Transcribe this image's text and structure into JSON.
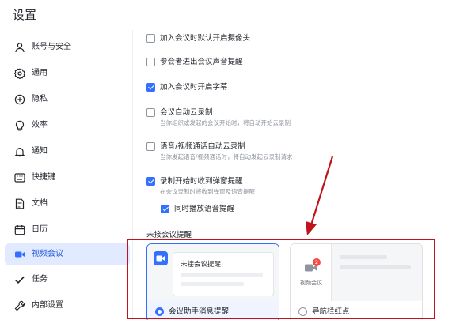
{
  "window": {
    "title": "设置"
  },
  "sidebar": {
    "items": [
      {
        "label": "账号与安全",
        "icon": "user-icon",
        "active": false
      },
      {
        "label": "通用",
        "icon": "gear-icon",
        "active": false
      },
      {
        "label": "隐私",
        "icon": "shield-icon",
        "active": false
      },
      {
        "label": "效率",
        "icon": "bulb-icon",
        "active": false
      },
      {
        "label": "通知",
        "icon": "bell-icon",
        "active": false
      },
      {
        "label": "快捷键",
        "icon": "keyboard-icon",
        "active": false
      },
      {
        "label": "文档",
        "icon": "document-icon",
        "active": false
      },
      {
        "label": "日历",
        "icon": "calendar-icon",
        "active": false
      },
      {
        "label": "视频会议",
        "icon": "video-camera-icon",
        "active": true
      },
      {
        "label": "任务",
        "icon": "check-icon",
        "active": false
      },
      {
        "label": "内部设置",
        "icon": "wrench-icon",
        "active": false
      }
    ]
  },
  "options": [
    {
      "label": "加入会议时默认开启摄像头",
      "desc": "",
      "checked": false
    },
    {
      "label": "参会者进出会议声音提醒",
      "desc": "",
      "checked": false
    },
    {
      "label": "加入会议时开启字幕",
      "desc": "",
      "checked": true
    },
    {
      "label": "会议自动云录制",
      "desc": "当你组织或发起的会议开始时，将自动开始云录制",
      "checked": false
    },
    {
      "label": "语音/视频通话自动云录制",
      "desc": "当你发起语音/视频通话时，将自动发起云录制请求",
      "checked": false
    },
    {
      "label": "录制开始时收到弹窗提醒",
      "desc": "在会议录制时将收到弹窗及语音提醒",
      "checked": true
    },
    {
      "label": "同时播放语音提醒",
      "desc": "",
      "checked": true
    }
  ],
  "reminder": {
    "section_title": "未接会议提醒",
    "cards": [
      {
        "preview_text": "未接会议提醒",
        "label": "会议助手消息提醒",
        "selected": true
      },
      {
        "preview_text": "视频会议",
        "badge": "2",
        "label": "导航栏红点",
        "selected": false
      }
    ]
  },
  "colors": {
    "accent": "#3370ff",
    "active_nav_bg": "#e1eaff",
    "annotation": "#c0141c"
  }
}
